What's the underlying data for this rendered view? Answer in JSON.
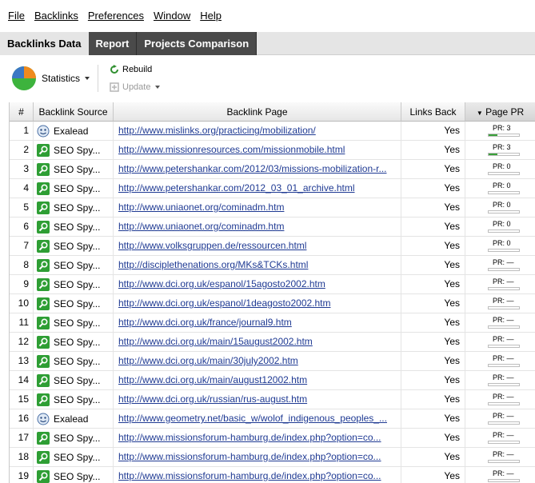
{
  "menu": [
    "File",
    "Backlinks",
    "Preferences",
    "Window",
    "Help"
  ],
  "tabs": [
    "Backlinks Data",
    "Report",
    "Projects Comparison"
  ],
  "toolbar": {
    "statistics_label": "Statistics",
    "rebuild_label": "Rebuild",
    "update_label": "Update"
  },
  "columns": [
    "#",
    "Backlink Source",
    "Backlink Page",
    "Links Back",
    "Page PR"
  ],
  "colors": {
    "pie_green": "#3db33d",
    "pie_orange": "#ef8a1e",
    "pie_blue": "#3b78c4",
    "link": "#1f3a93",
    "pr_bar": "#3aa13a"
  },
  "rows": [
    {
      "num": "1",
      "source": "Exalead",
      "source_icon": "exalead-icon",
      "page": "http://www.mislinks.org/practicing/mobilization/",
      "links_back": "Yes",
      "pr": "PR: 3",
      "pr_level": 0.3
    },
    {
      "num": "2",
      "source": "SEO Spy...",
      "source_icon": "seo-spyglass-icon",
      "page": "http://www.missionresources.com/missionmobile.html",
      "links_back": "Yes",
      "pr": "PR: 3",
      "pr_level": 0.3
    },
    {
      "num": "3",
      "source": "SEO Spy...",
      "source_icon": "seo-spyglass-icon",
      "page": "http://www.petershankar.com/2012/03/missions-mobilization-r...",
      "links_back": "Yes",
      "pr": "PR: 0",
      "pr_level": 0
    },
    {
      "num": "4",
      "source": "SEO Spy...",
      "source_icon": "seo-spyglass-icon",
      "page": "http://www.petershankar.com/2012_03_01_archive.html",
      "links_back": "Yes",
      "pr": "PR: 0",
      "pr_level": 0
    },
    {
      "num": "5",
      "source": "SEO Spy...",
      "source_icon": "seo-spyglass-icon",
      "page": "http://www.uniaonet.org/cominadm.htm",
      "links_back": "Yes",
      "pr": "PR: 0",
      "pr_level": 0
    },
    {
      "num": "6",
      "source": "SEO Spy...",
      "source_icon": "seo-spyglass-icon",
      "page": "http://www.uniaonet.org/cominadm.htm",
      "links_back": "Yes",
      "pr": "PR: 0",
      "pr_level": 0
    },
    {
      "num": "7",
      "source": "SEO Spy...",
      "source_icon": "seo-spyglass-icon",
      "page": "http://www.volksgruppen.de/ressourcen.html",
      "links_back": "Yes",
      "pr": "PR: 0",
      "pr_level": 0
    },
    {
      "num": "8",
      "source": "SEO Spy...",
      "source_icon": "seo-spyglass-icon",
      "page": "http://disciplethenations.org/MKs&TCKs.html",
      "links_back": "Yes",
      "pr": "PR: —",
      "pr_level": 0
    },
    {
      "num": "9",
      "source": "SEO Spy...",
      "source_icon": "seo-spyglass-icon",
      "page": "http://www.dci.org.uk/espanol/15agosto2002.htm",
      "links_back": "Yes",
      "pr": "PR: —",
      "pr_level": 0
    },
    {
      "num": "10",
      "source": "SEO Spy...",
      "source_icon": "seo-spyglass-icon",
      "page": "http://www.dci.org.uk/espanol/1deagosto2002.htm",
      "links_back": "Yes",
      "pr": "PR: —",
      "pr_level": 0
    },
    {
      "num": "11",
      "source": "SEO Spy...",
      "source_icon": "seo-spyglass-icon",
      "page": "http://www.dci.org.uk/france/journal9.htm",
      "links_back": "Yes",
      "pr": "PR: —",
      "pr_level": 0
    },
    {
      "num": "12",
      "source": "SEO Spy...",
      "source_icon": "seo-spyglass-icon",
      "page": "http://www.dci.org.uk/main/15august2002.htm",
      "links_back": "Yes",
      "pr": "PR: —",
      "pr_level": 0
    },
    {
      "num": "13",
      "source": "SEO Spy...",
      "source_icon": "seo-spyglass-icon",
      "page": "http://www.dci.org.uk/main/30july2002.htm",
      "links_back": "Yes",
      "pr": "PR: —",
      "pr_level": 0
    },
    {
      "num": "14",
      "source": "SEO Spy...",
      "source_icon": "seo-spyglass-icon",
      "page": "http://www.dci.org.uk/main/august12002.htm",
      "links_back": "Yes",
      "pr": "PR: —",
      "pr_level": 0
    },
    {
      "num": "15",
      "source": "SEO Spy...",
      "source_icon": "seo-spyglass-icon",
      "page": "http://www.dci.org.uk/russian/rus-august.htm",
      "links_back": "Yes",
      "pr": "PR: —",
      "pr_level": 0
    },
    {
      "num": "16",
      "source": "Exalead",
      "source_icon": "exalead-icon",
      "page": "http://www.geometry.net/basic_w/wolof_indigenous_peoples_...",
      "links_back": "Yes",
      "pr": "PR: —",
      "pr_level": 0
    },
    {
      "num": "17",
      "source": "SEO Spy...",
      "source_icon": "seo-spyglass-icon",
      "page": "http://www.missionsforum-hamburg.de/index.php?option=co...",
      "links_back": "Yes",
      "pr": "PR: —",
      "pr_level": 0
    },
    {
      "num": "18",
      "source": "SEO Spy...",
      "source_icon": "seo-spyglass-icon",
      "page": "http://www.missionsforum-hamburg.de/index.php?option=co...",
      "links_back": "Yes",
      "pr": "PR: —",
      "pr_level": 0
    },
    {
      "num": "19",
      "source": "SEO Spy...",
      "source_icon": "seo-spyglass-icon",
      "page": "http://www.missionsforum-hamburg.de/index.php?option=co...",
      "links_back": "Yes",
      "pr": "PR: —",
      "pr_level": 0
    }
  ]
}
